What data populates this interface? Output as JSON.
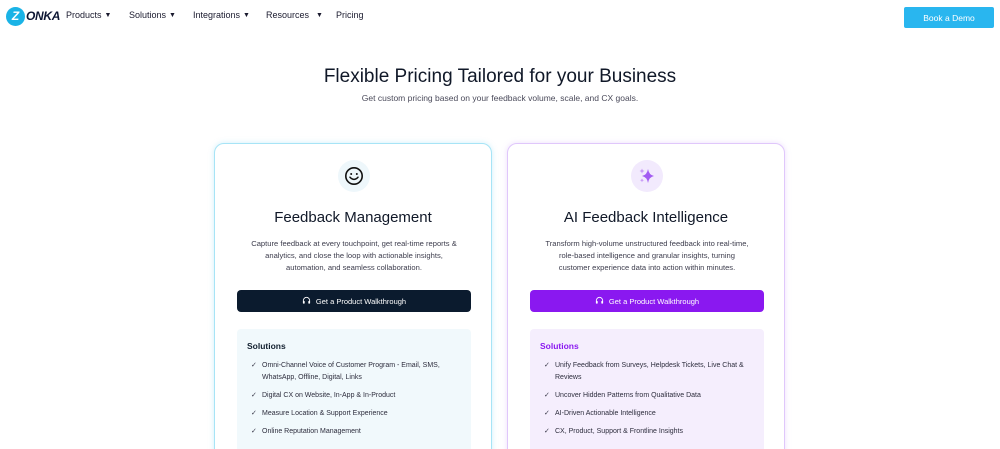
{
  "nav": {
    "logo_text": "ONKA",
    "logo_letter": "Z",
    "items": [
      {
        "label": "Products",
        "caret": true
      },
      {
        "label": "Solutions",
        "caret": true
      },
      {
        "label": "Integrations",
        "caret": true
      },
      {
        "label": "Resources",
        "caret": true
      },
      {
        "label": "Pricing",
        "caret": false
      }
    ],
    "cta_label": "Book a Demo"
  },
  "hero": {
    "title": "Flexible Pricing Tailored for your Business",
    "subtitle": "Get custom pricing based on your feedback volume, scale, and CX goals."
  },
  "cards": [
    {
      "icon": "smiley-face-icon",
      "title": "Feedback Management",
      "description": "Capture feedback at every touchpoint, get real-time reports & analytics, and close the loop with actionable insights, automation, and seamless collaboration.",
      "button_label": "Get a Product Walkthrough",
      "solutions_heading": "Solutions",
      "solutions": [
        "Omni-Channel Voice of Customer Program - Email, SMS, WhatsApp, Offline, Digital, Links",
        "Digital CX on Website, In-App & In-Product",
        "Measure Location & Support Experience",
        "Online Reputation Management"
      ]
    },
    {
      "icon": "sparkles-icon",
      "title": "AI Feedback Intelligence",
      "description": "Transform high-volume unstructured feedback into real-time, role-based intelligence and granular insights, turning customer experience data into action within minutes.",
      "button_label": "Get a Product Walkthrough",
      "solutions_heading": "Solutions",
      "solutions": [
        "Unify Feedback from Surveys, Helpdesk Tickets, Live Chat & Reviews",
        "Uncover Hidden Patterns from Qualitative Data",
        "AI-Driven Actionable Intelligence",
        "CX, Product, Support & Frontline Insights"
      ]
    }
  ],
  "colors": {
    "brand_blue": "#29b6ef",
    "dark_navy": "#0b1b2e",
    "ai_purple": "#8a18f0"
  }
}
